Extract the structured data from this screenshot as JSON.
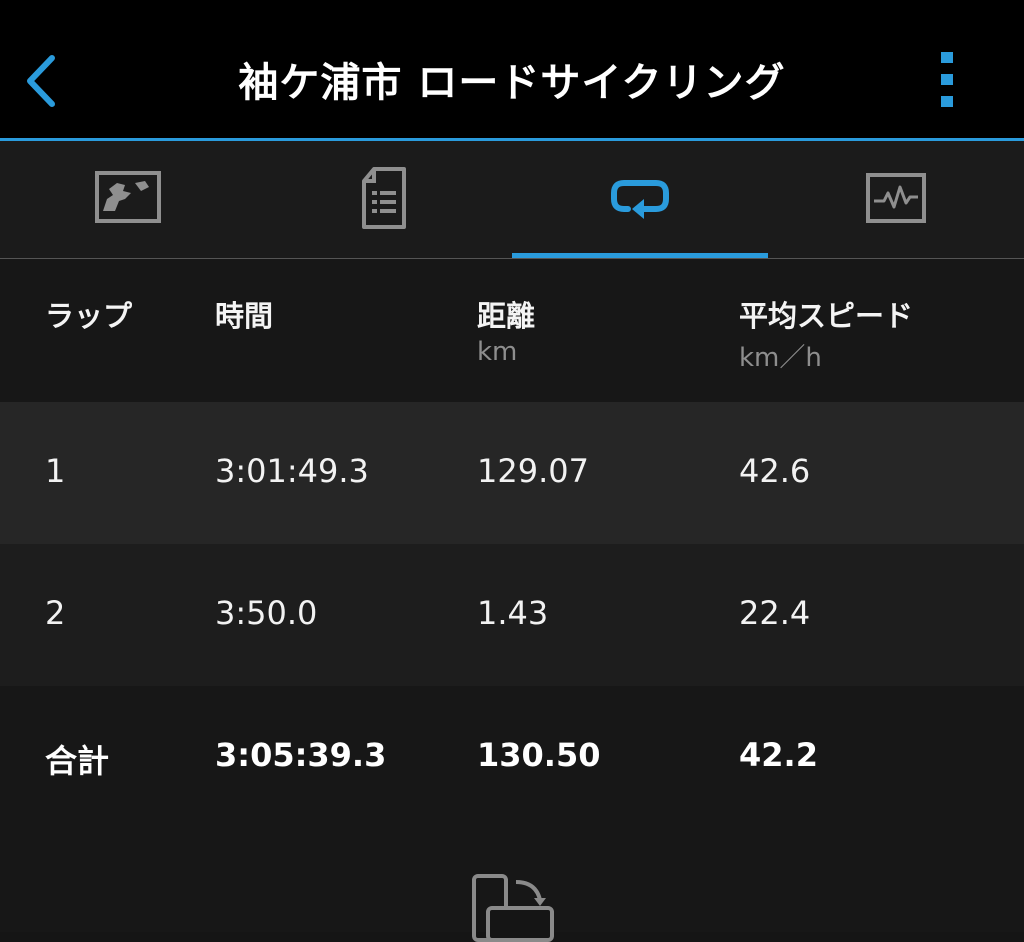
{
  "header": {
    "title": "袖ケ浦市 ロードサイクリング",
    "back_icon": "chevron-left-icon",
    "menu_icon": "vertical-dots-icon",
    "accent_color": "#2a9bdc"
  },
  "tabs": [
    {
      "icon": "map-icon",
      "active": false
    },
    {
      "icon": "details-list-icon",
      "active": false
    },
    {
      "icon": "laps-icon",
      "active": true
    },
    {
      "icon": "chart-icon",
      "active": false
    }
  ],
  "table": {
    "columns": [
      {
        "label": "ラップ",
        "unit": ""
      },
      {
        "label": "時間",
        "unit": ""
      },
      {
        "label": "距離",
        "unit": "km"
      },
      {
        "label": "平均スピード",
        "unit": "km／h"
      }
    ],
    "rows": [
      {
        "lap": "1",
        "time": "3:01:49.3",
        "distance": "129.07",
        "avg_speed": "42.6"
      },
      {
        "lap": "2",
        "time": "3:50.0",
        "distance": "1.43",
        "avg_speed": "22.4"
      }
    ],
    "total": {
      "lap": "合計",
      "time": "3:05:39.3",
      "distance": "130.50",
      "avg_speed": "42.2"
    }
  },
  "footer": {
    "icon": "rotate-device-icon"
  }
}
